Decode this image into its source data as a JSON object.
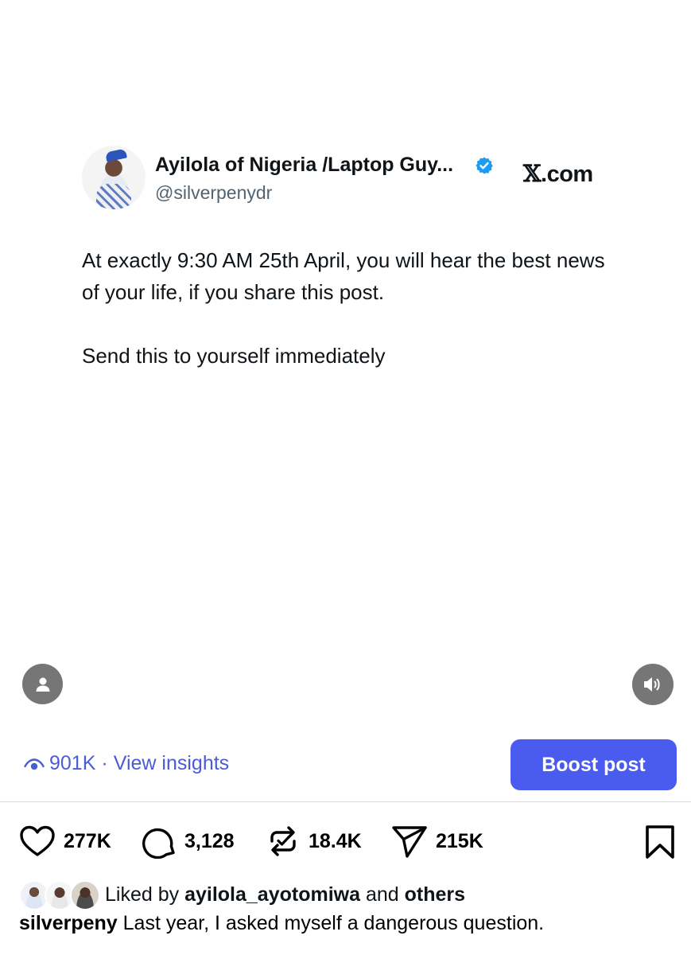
{
  "tweet": {
    "display_name": "Ayilola of Nigeria /Laptop Guy...",
    "handle": "@silverpenydr",
    "source": "X.com",
    "source_mark": "𝕏",
    "source_suffix": ".com",
    "paragraphs": [
      "At exactly 9:30 AM 25th April, you will hear the best news of your life, if you share this post.",
      "Send this to yourself immediately"
    ],
    "verified_color": "#1d9bf0"
  },
  "media_controls": {
    "profile_icon": "person-icon",
    "sound_icon": "speaker-icon"
  },
  "insights": {
    "views": "901K",
    "separator": "·",
    "link_label": "View insights"
  },
  "boost": {
    "label": "Boost post",
    "color": "#4a5cf0"
  },
  "actions": {
    "likes": "277K",
    "comments": "3,128",
    "reposts": "18.4K",
    "shares": "215K"
  },
  "liked_by": {
    "prefix": "Liked by",
    "user": "ayilola_ayotomiwa",
    "middle": "and",
    "others": "others"
  },
  "caption": {
    "username": "silverpeny",
    "text": "Last year, I asked myself a dangerous question."
  },
  "colors": {
    "accent": "#4a5cd8",
    "text": "#0f1419",
    "muted": "#536471"
  }
}
